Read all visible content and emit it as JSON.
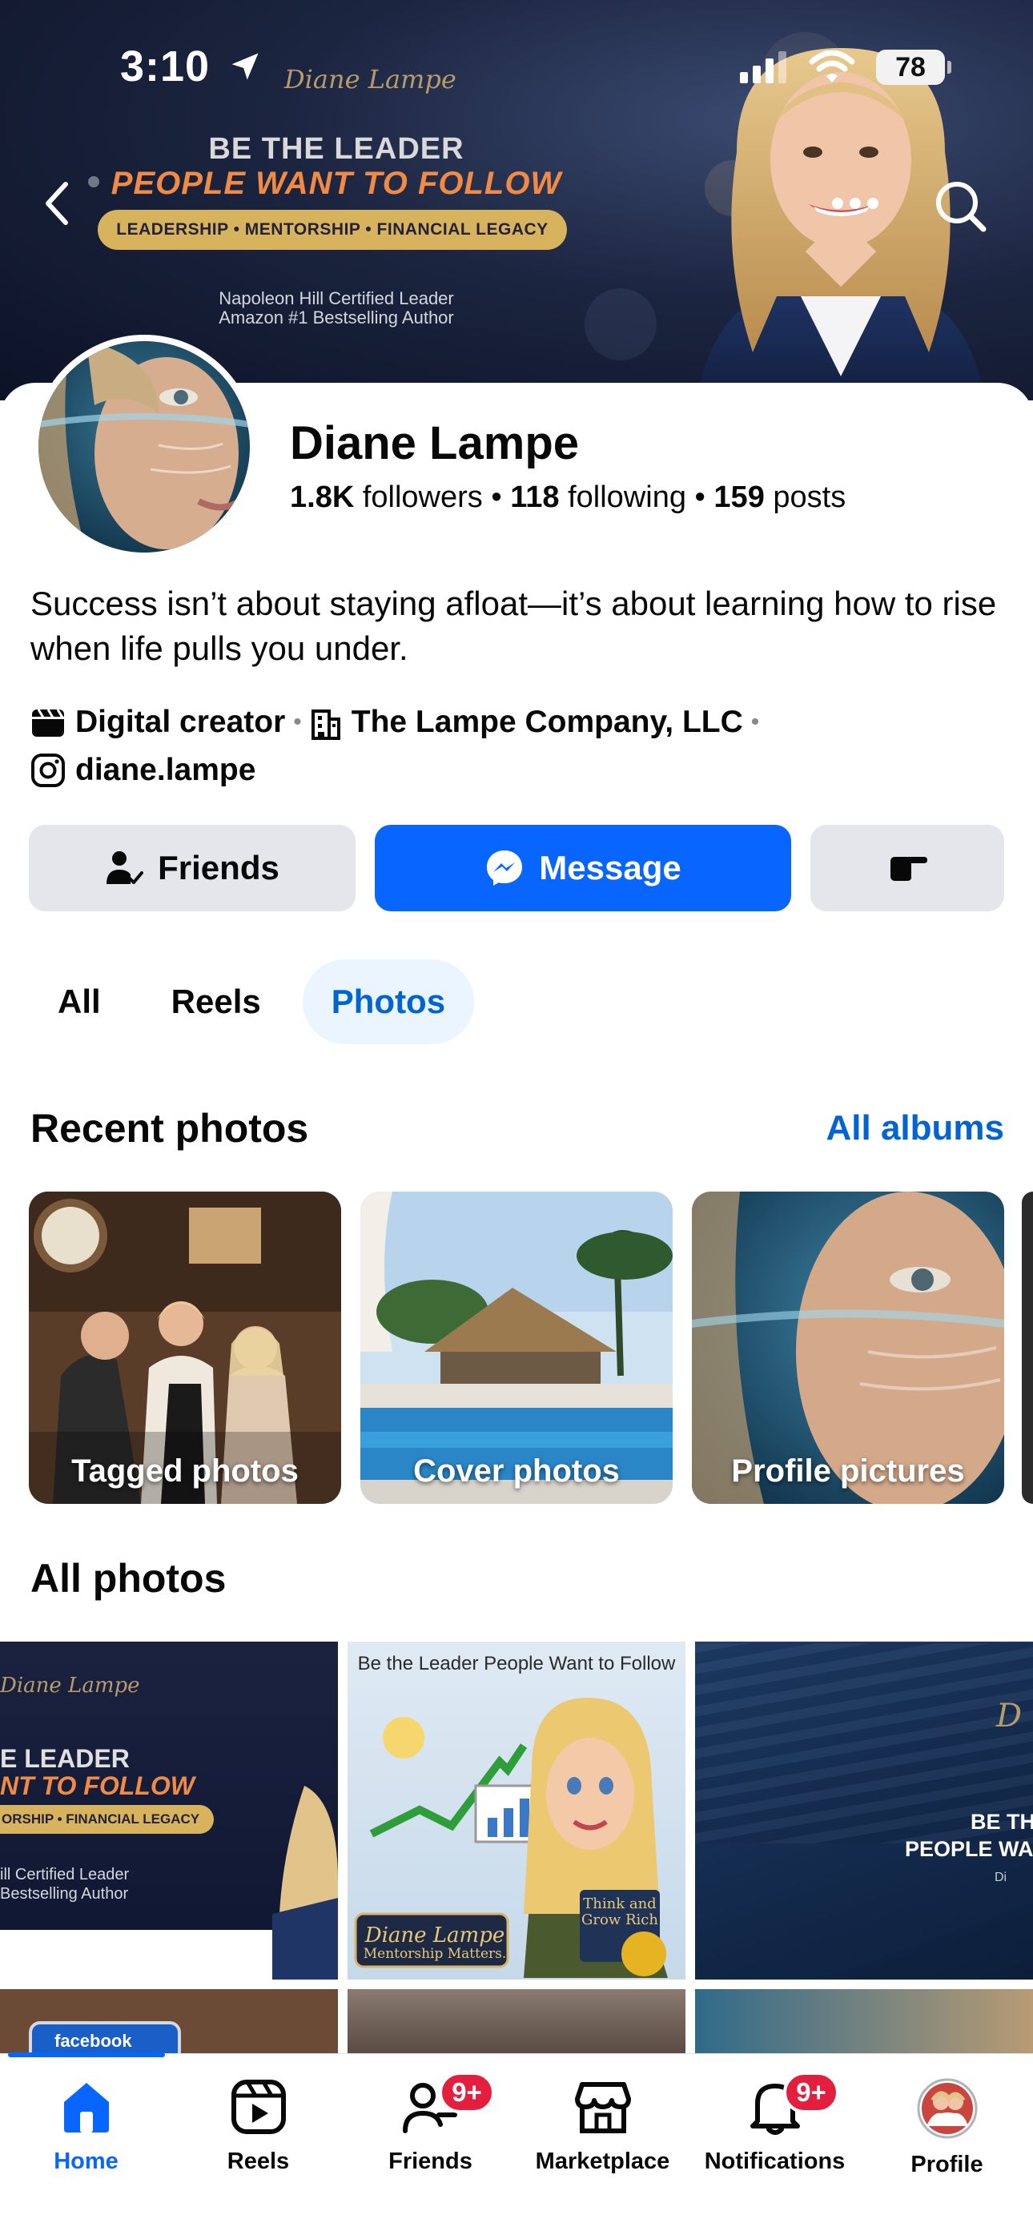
{
  "status_bar": {
    "time": "3:10",
    "battery": "78"
  },
  "cover": {
    "signature": "Diane Lampe",
    "title_line1": "BE THE LEADER",
    "title_line2": "PEOPLE WANT TO FOLLOW",
    "pill": "LEADERSHIP • MENTORSHIP • FINANCIAL LEGACY",
    "sub_line1": "Napoleon Hill Certified Leader",
    "sub_line2": "Amazon #1 Bestselling Author"
  },
  "profile": {
    "name": "Diane Lampe",
    "followers_count": "1.8K",
    "followers_label": "followers",
    "following_count": "118",
    "following_label": "following",
    "posts_count": "159",
    "posts_label": "posts",
    "separator": "•",
    "bio": "Success isn’t about staying afloat—it’s about learning how to rise when life pulls you under.",
    "category": "Digital creator",
    "company": "The Lampe Company, LLC",
    "instagram": "diane.lampe"
  },
  "actions": {
    "friends": "Friends",
    "message": "Message"
  },
  "tabs": [
    {
      "label": "All",
      "active": false
    },
    {
      "label": "Reels",
      "active": false
    },
    {
      "label": "Photos",
      "active": true
    }
  ],
  "recent_photos": {
    "title": "Recent photos",
    "all_albums": "All albums",
    "albums": [
      {
        "label": "Tagged photos"
      },
      {
        "label": "Cover photos"
      },
      {
        "label": "Profile pictures"
      }
    ]
  },
  "all_photos": {
    "title": "All photos",
    "tile1": {
      "sig": "Diane Lampe",
      "line1": "E LEADER",
      "line2": "NT TO FOLLOW",
      "pill": "ORSHIP • FINANCIAL LEGACY",
      "sub1": "ill Certified Leader",
      "sub2": "Bestselling Author"
    },
    "tile2": {
      "header": "Be the Leader People Want to Follow",
      "sign_name": "Diane Lampe",
      "sign_tag": "Mentorship Matters.",
      "book_title": "Think and Grow Rich"
    },
    "tile3": {
      "sig": "D",
      "line1": "BE TH",
      "line2": "PEOPLE WA",
      "line3": "Di"
    },
    "tile4": {
      "phone_text": "facebook"
    }
  },
  "nav": {
    "items": [
      {
        "label": "Home",
        "active": true
      },
      {
        "label": "Reels"
      },
      {
        "label": "Friends",
        "badge": "9+"
      },
      {
        "label": "Marketplace"
      },
      {
        "label": "Notifications",
        "badge": "9+"
      },
      {
        "label": "Profile"
      }
    ]
  },
  "colors": {
    "accent": "#0866ff",
    "link": "#0064d1",
    "badge": "#e41e3f",
    "button_gray": "#e4e6eb"
  }
}
